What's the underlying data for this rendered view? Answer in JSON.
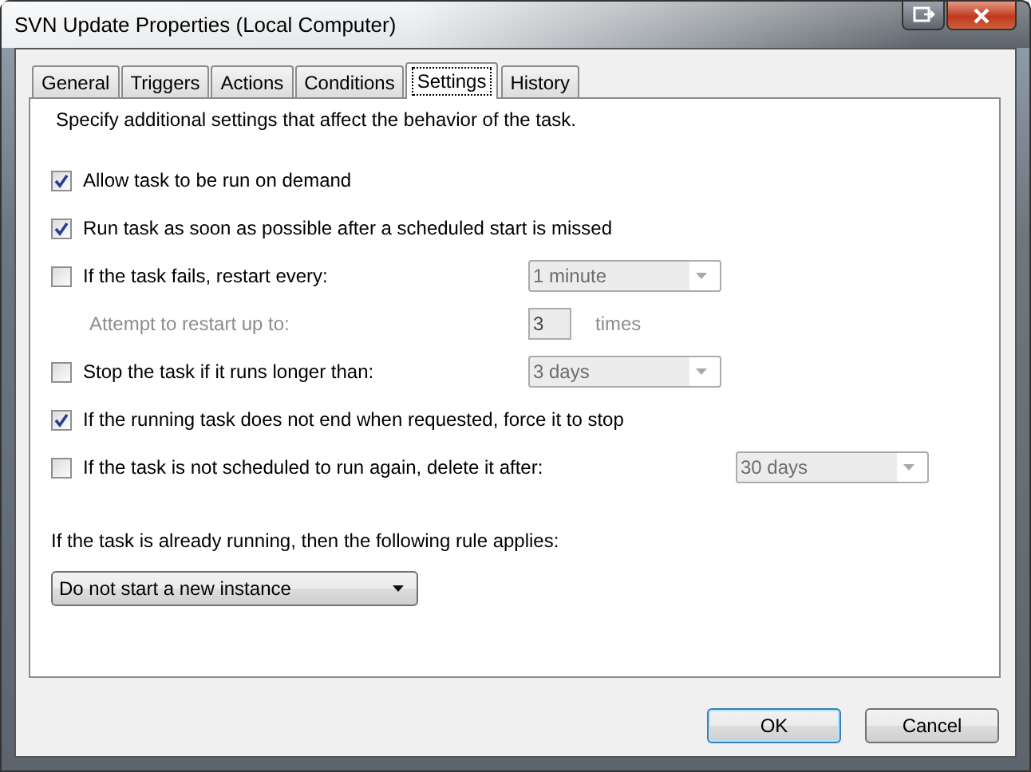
{
  "window": {
    "title": "SVN Update Properties (Local Computer)"
  },
  "tabs": [
    {
      "label": "General",
      "selected": false
    },
    {
      "label": "Triggers",
      "selected": false
    },
    {
      "label": "Actions",
      "selected": false
    },
    {
      "label": "Conditions",
      "selected": false
    },
    {
      "label": "Settings",
      "selected": true
    },
    {
      "label": "History",
      "selected": false
    }
  ],
  "intro": "Specify additional settings that affect the behavior of the task.",
  "options": [
    {
      "kind": "checkbox",
      "label": "Allow task to be run on demand",
      "checked": true
    },
    {
      "kind": "checkbox",
      "label": "Run task as soon as possible after a scheduled start is missed",
      "checked": true
    },
    {
      "kind": "checkbox",
      "label": "If the task fails, restart every:",
      "checked": false,
      "control": {
        "kind": "dropdown",
        "value": "1 minute",
        "disabled": true
      }
    },
    {
      "kind": "indented",
      "label": "Attempt to restart up to:",
      "disabled": true,
      "control": {
        "kind": "number",
        "value": "3",
        "suffix": "times",
        "disabled": true
      }
    },
    {
      "kind": "checkbox",
      "label": "Stop the task if it runs longer than:",
      "checked": false,
      "control": {
        "kind": "dropdown",
        "value": "3 days",
        "disabled": true
      }
    },
    {
      "kind": "checkbox",
      "label": "If the running task does not end when requested, force it to stop",
      "checked": true
    },
    {
      "kind": "checkbox",
      "label": "If the task is not scheduled to run again, delete it after:",
      "checked": false,
      "control": {
        "kind": "dropdown",
        "value": "30 days",
        "disabled": true
      }
    }
  ],
  "rule": {
    "label": "If the task is already running, then the following rule applies:",
    "value": "Do not start a new instance"
  },
  "buttons": [
    {
      "label": "OK",
      "default": true
    },
    {
      "label": "Cancel",
      "default": false
    }
  ]
}
